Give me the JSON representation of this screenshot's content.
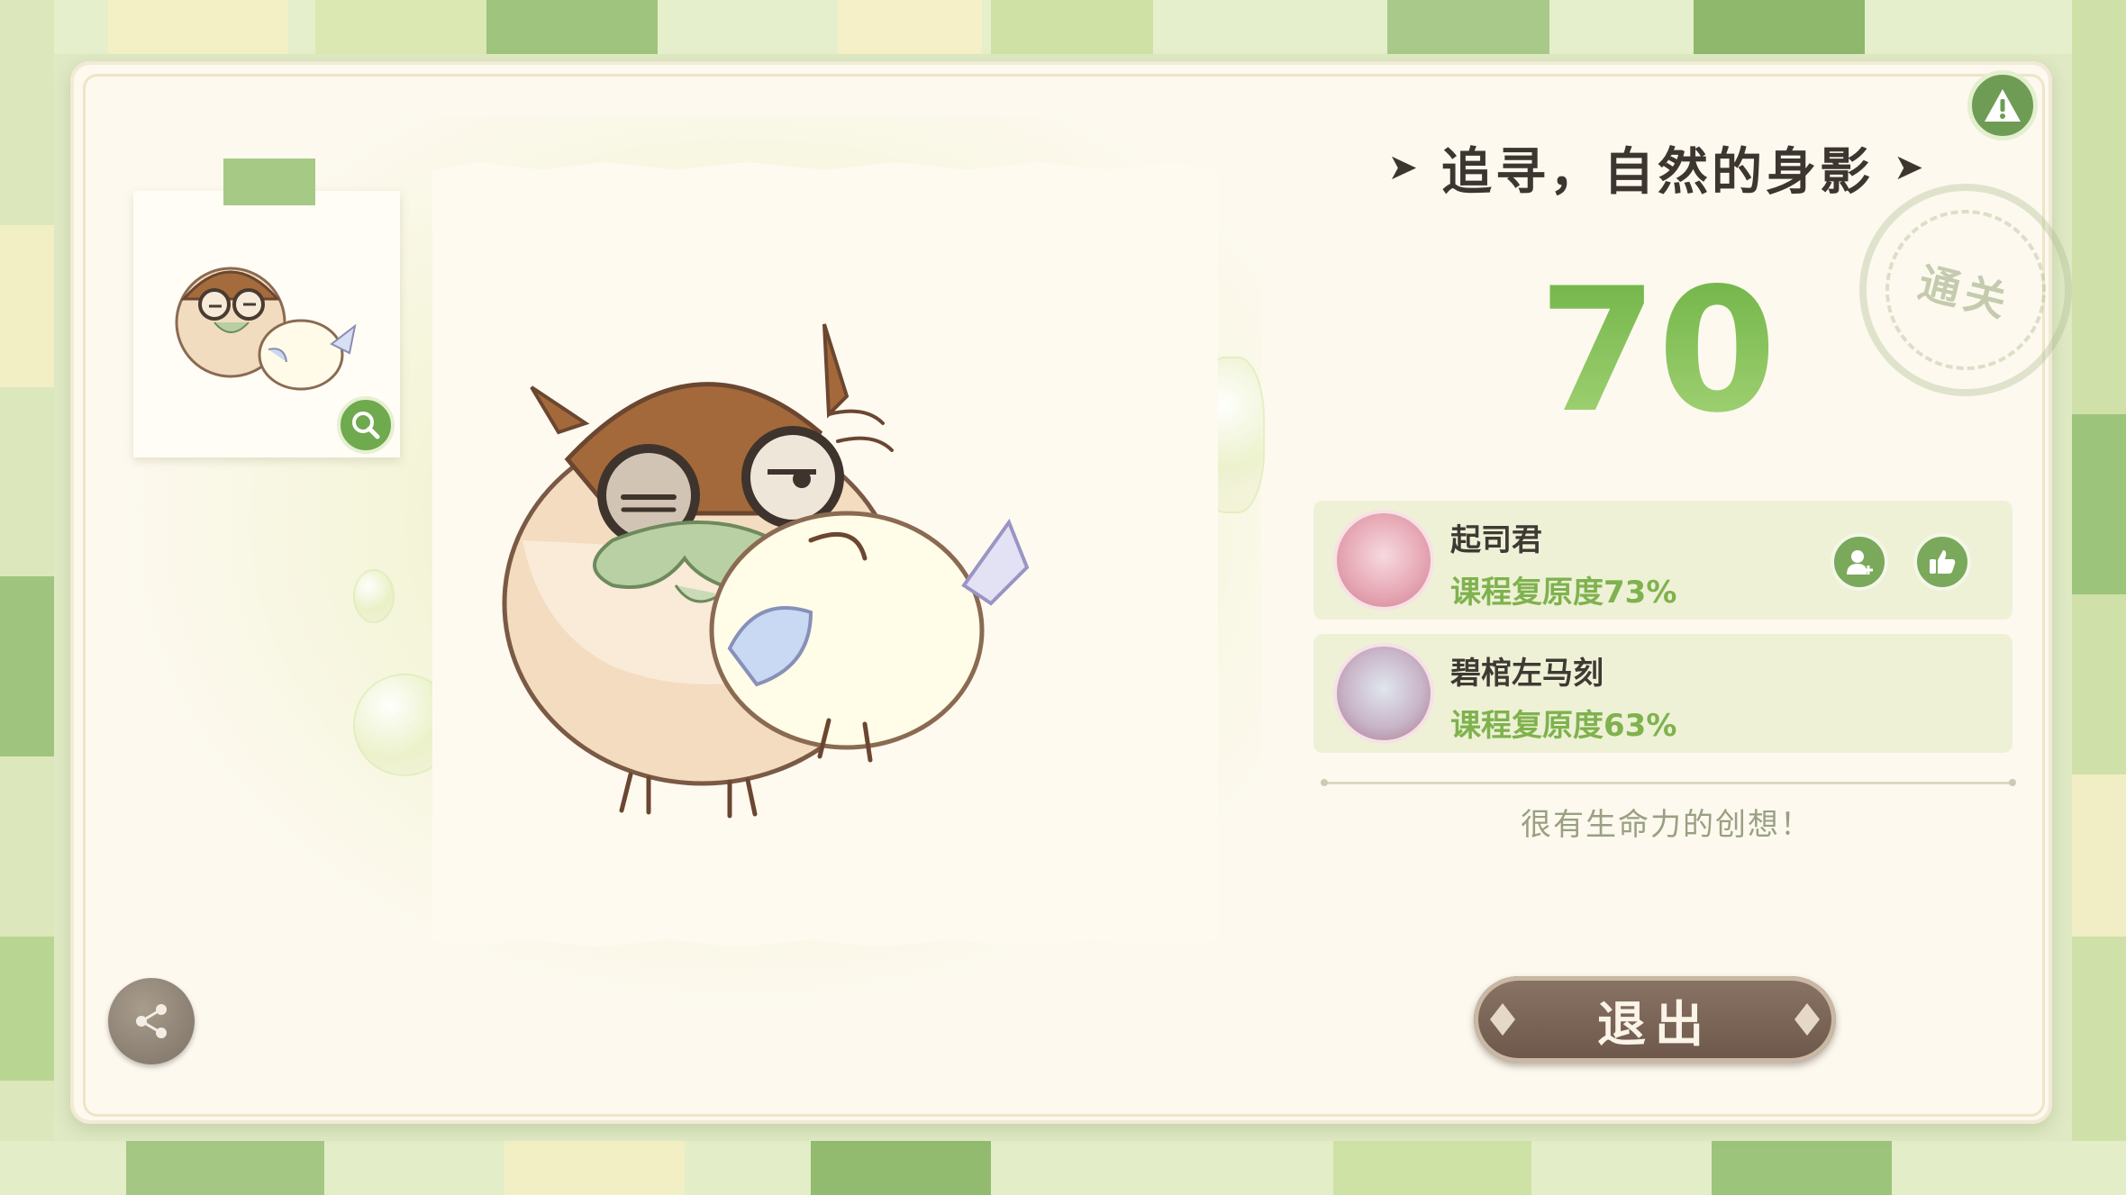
{
  "header": {
    "title": "追寻，自然的身影",
    "stamp_text": "通关"
  },
  "result": {
    "score": "70",
    "comment": "很有生命力的创想！"
  },
  "players": [
    {
      "name": "起司君",
      "similarity": "课程复原度73%"
    },
    {
      "name": "碧棺左马刻",
      "similarity": "课程复原度63%"
    }
  ],
  "buttons": {
    "exit_label": "退出"
  },
  "icons": {
    "warning": "warning-icon",
    "share": "share-icon",
    "zoom": "search-icon",
    "add_friend": "add-friend-icon",
    "like": "thumbs-up-icon",
    "plane": "paper-plane-icon"
  },
  "colors": {
    "accent_green": "#7fb24e",
    "exit_button": "#6c574a",
    "card_background": "#fdf9ef"
  }
}
